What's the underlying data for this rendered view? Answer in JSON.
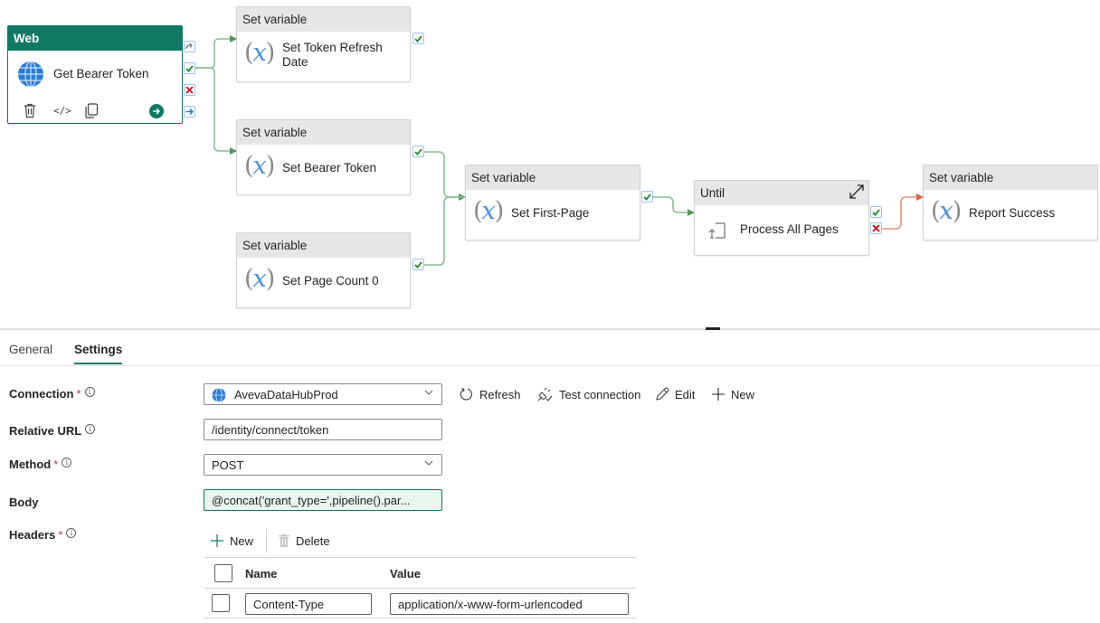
{
  "canvas": {
    "web_activity": {
      "type_label": "Web",
      "name": "Get Bearer Token",
      "actions": [
        "delete-icon",
        "code-icon",
        "copy-icon",
        "run-arrow-icon"
      ],
      "ports": [
        "skip",
        "success",
        "failure",
        "completion"
      ]
    },
    "activities": [
      {
        "id": "set-token-refresh-date",
        "type_label": "Set variable",
        "name_line1": "Set Token Refresh",
        "name_line2": "Date"
      },
      {
        "id": "set-bearer-token",
        "type_label": "Set variable",
        "name_line1": "Set Bearer Token",
        "name_line2": ""
      },
      {
        "id": "set-page-count-0",
        "type_label": "Set variable",
        "name_line1": "Set Page Count 0",
        "name_line2": ""
      },
      {
        "id": "set-first-page",
        "type_label": "Set variable",
        "name_line1": "Set First-Page",
        "name_line2": ""
      },
      {
        "id": "process-all-pages",
        "type_label": "Until",
        "name_line1": "Process All Pages",
        "name_line2": ""
      },
      {
        "id": "report-success",
        "type_label": "Set variable",
        "name_line1": "Report Success",
        "name_line2": ""
      }
    ],
    "colors": {
      "success_edge": "#4f9a5a",
      "failure_edge": "#d9634b",
      "web_header": "#117865"
    }
  },
  "panel": {
    "tabs": [
      {
        "label": "General",
        "active": false
      },
      {
        "label": "Settings",
        "active": true
      }
    ],
    "fields": {
      "connection": {
        "label": "Connection",
        "required": true,
        "value": "AvevaDataHubProd"
      },
      "relative_url": {
        "label": "Relative URL",
        "required": false,
        "value": "/identity/connect/token"
      },
      "method": {
        "label": "Method",
        "required": true,
        "value": "POST"
      },
      "body": {
        "label": "Body",
        "required": false,
        "value": "@concat('grant_type=',pipeline().par..."
      },
      "headers": {
        "label": "Headers",
        "required": true
      }
    },
    "connection_actions": {
      "refresh": "Refresh",
      "test_connection": "Test connection",
      "edit": "Edit",
      "new": "New"
    },
    "headers_toolbar": {
      "new": "New",
      "delete": "Delete"
    },
    "headers_table": {
      "columns": [
        "Name",
        "Value"
      ],
      "rows": [
        {
          "name": "Content-Type",
          "value": "application/x-www-form-urlencoded"
        }
      ]
    },
    "required_marker": "*",
    "info_marker": "i"
  }
}
